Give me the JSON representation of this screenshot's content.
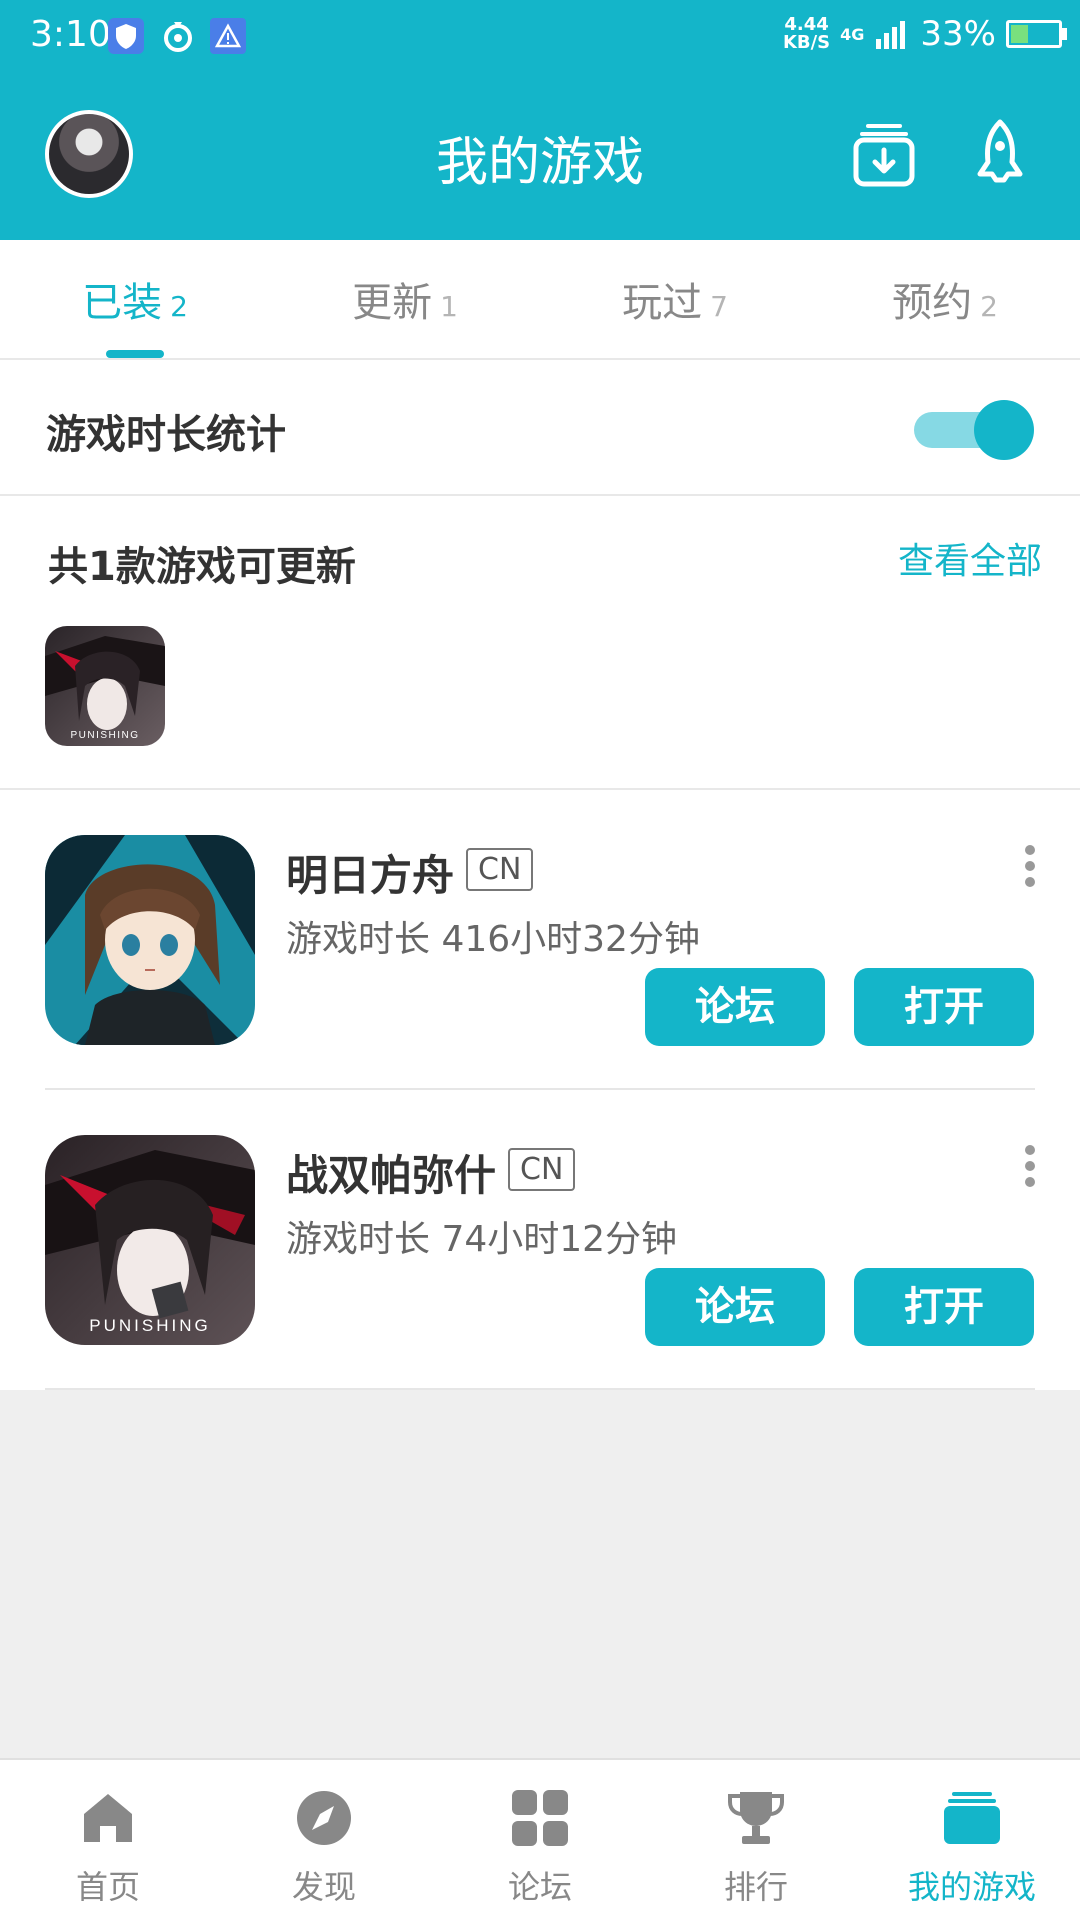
{
  "status_bar": {
    "time": "3:10",
    "speed_value": "4.44",
    "speed_unit": "KB/S",
    "network": "4G",
    "battery": "33%",
    "battery_fraction": 0.33
  },
  "header": {
    "title": "我的游戏"
  },
  "tabs": [
    {
      "label": "已装",
      "count": "2",
      "active": true
    },
    {
      "label": "更新",
      "count": "1",
      "active": false
    },
    {
      "label": "玩过",
      "count": "7",
      "active": false
    },
    {
      "label": "预约",
      "count": "2",
      "active": false
    }
  ],
  "stats": {
    "label": "游戏时长统计",
    "toggle_on": true
  },
  "updates": {
    "title": "共1款游戏可更新",
    "view_all": "查看全部",
    "icon_caption": "PUNISHING"
  },
  "games": [
    {
      "name": "明日方舟",
      "region": "CN",
      "playtime": "游戏时长 416小时32分钟",
      "forum_label": "论坛",
      "open_label": "打开"
    },
    {
      "name": "战双帕弥什",
      "region": "CN",
      "playtime": "游戏时长 74小时12分钟",
      "forum_label": "论坛",
      "open_label": "打开",
      "icon_caption": "PUNISHING"
    }
  ],
  "bottom_nav": [
    {
      "label": "首页",
      "icon": "home-icon",
      "active": false
    },
    {
      "label": "发现",
      "icon": "compass-icon",
      "active": false
    },
    {
      "label": "论坛",
      "icon": "grid-icon",
      "active": false
    },
    {
      "label": "排行",
      "icon": "trophy-icon",
      "active": false
    },
    {
      "label": "我的游戏",
      "icon": "my-games-icon",
      "active": true
    }
  ],
  "colors": {
    "accent": "#14b5c9",
    "accent_light": "#86d9e4",
    "inactive": "#888888",
    "background": "#efefef"
  }
}
